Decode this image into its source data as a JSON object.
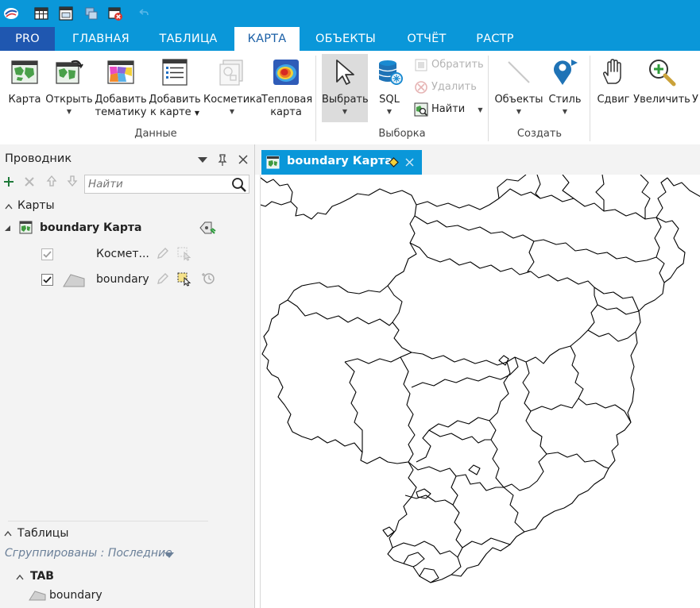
{
  "titlebar": {
    "icons": [
      "app-logo-icon",
      "table-icon",
      "window-icon",
      "layers-icon",
      "close-table-icon",
      "undo-icon"
    ]
  },
  "ribbon_tabs": [
    {
      "label": "PRO"
    },
    {
      "label": "ГЛАВНАЯ"
    },
    {
      "label": "ТАБЛИЦА"
    },
    {
      "label": "КАРТА"
    },
    {
      "label": "ОБЪЕКТЫ"
    },
    {
      "label": "ОТЧЁТ"
    },
    {
      "label": "РАСТР"
    }
  ],
  "ribbon": {
    "data_group": {
      "label": "Данные",
      "map": "Карта",
      "open": "Открыть",
      "add_theme_1": "Добавить",
      "add_theme_2": "тематику",
      "add_map_1": "Добавить",
      "add_map_2": "к карте",
      "cosmetic": "Косметика",
      "heat_1": "Тепловая",
      "heat_2": "карта"
    },
    "selection_group": {
      "label": "Выборка",
      "select": "Выбрать",
      "sql": "SQL",
      "invert": "Обратить",
      "delete": "Удалить",
      "find": "Найти"
    },
    "create_group": {
      "label": "Создать",
      "objects": "Объекты",
      "style": "Стиль"
    },
    "nav": {
      "pan": "Сдвиг",
      "zoom_in": "Увеличить",
      "cut": "У"
    }
  },
  "explorer": {
    "title": "Проводник",
    "search_placeholder": "Найти",
    "maps_header": "Карты",
    "map_name": "boundary Карта",
    "layers": [
      {
        "name": "Космет...",
        "checked": true,
        "enabled": false
      },
      {
        "name": "boundary",
        "checked": true,
        "enabled": true
      }
    ],
    "tables_header": "Таблицы",
    "grouped_by": "Сгруппированы : Последние",
    "tab_group": "TAB",
    "table_name": "boundary"
  },
  "document": {
    "tab_title": "boundary Карта"
  },
  "colors": {
    "accent": "#0a97d9",
    "pro_tab": "#1f57b0",
    "active_tab_text": "#1a5fa6",
    "panel": "#f3f3f3",
    "map_stroke": "#000000"
  }
}
